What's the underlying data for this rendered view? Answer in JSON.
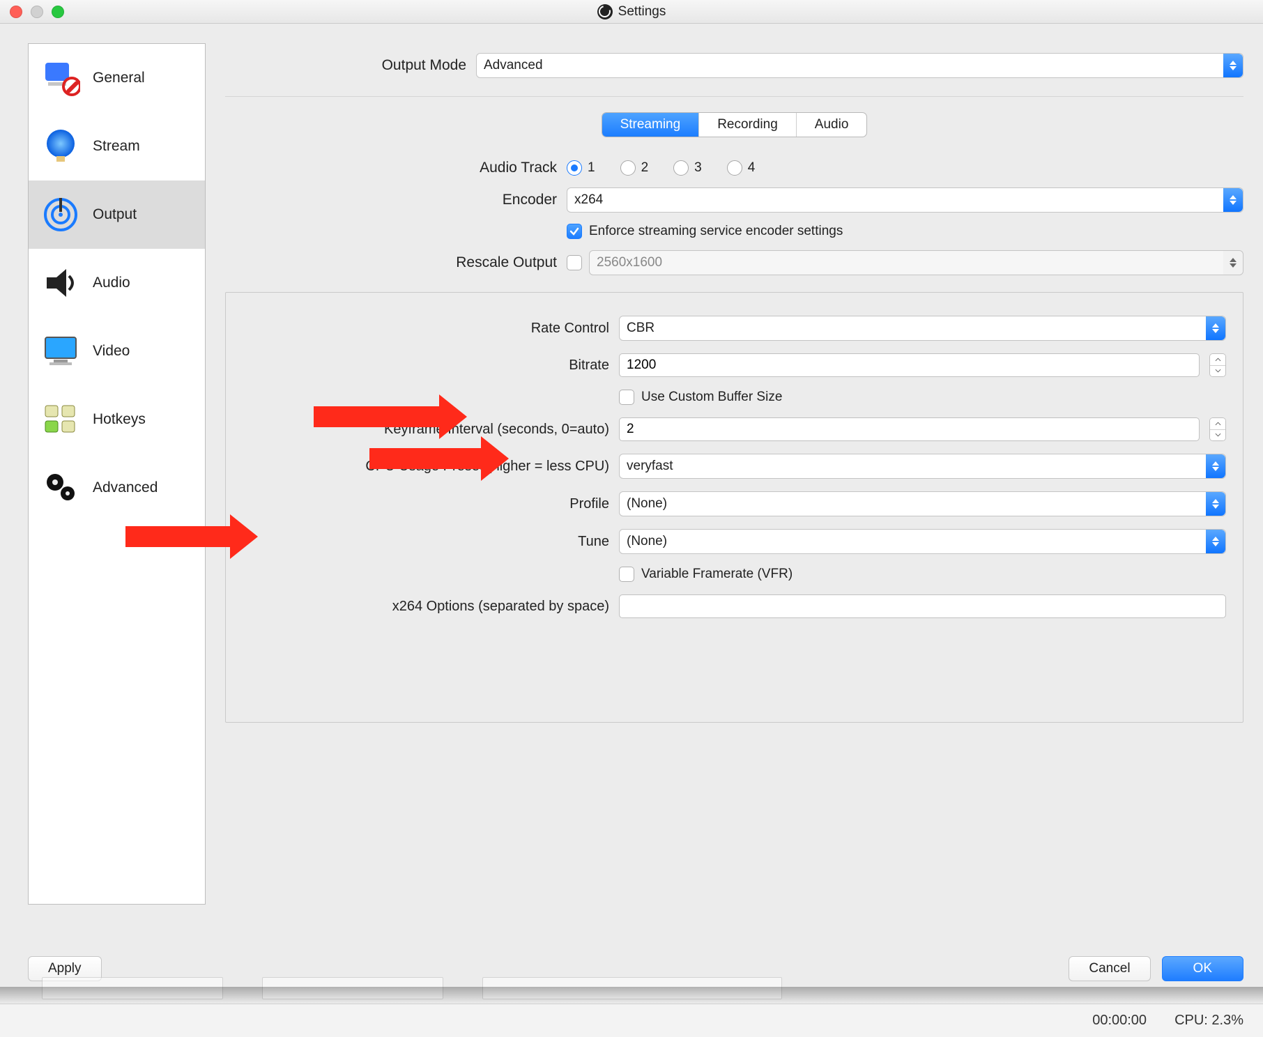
{
  "title": "Settings",
  "sidebar": {
    "items": [
      {
        "label": "General"
      },
      {
        "label": "Stream"
      },
      {
        "label": "Output"
      },
      {
        "label": "Audio"
      },
      {
        "label": "Video"
      },
      {
        "label": "Hotkeys"
      },
      {
        "label": "Advanced"
      }
    ],
    "selected_index": 2
  },
  "top": {
    "output_mode_label": "Output Mode",
    "output_mode_value": "Advanced"
  },
  "tabs": {
    "streaming": "Streaming",
    "recording": "Recording",
    "audio": "Audio",
    "active": "streaming"
  },
  "streaming": {
    "audio_track_label": "Audio Track",
    "tracks": [
      "1",
      "2",
      "3",
      "4"
    ],
    "track_selected": 0,
    "encoder_label": "Encoder",
    "encoder_value": "x264",
    "enforce_label": "Enforce streaming service encoder settings",
    "enforce_checked": true,
    "rescale_label": "Rescale Output",
    "rescale_checked": false,
    "rescale_value": "2560x1600"
  },
  "panel": {
    "rate_control_label": "Rate Control",
    "rate_control_value": "CBR",
    "bitrate_label": "Bitrate",
    "bitrate_value": "1200",
    "custom_buffer_label": "Use Custom Buffer Size",
    "custom_buffer_checked": false,
    "keyframe_label": "Keyframe Interval (seconds, 0=auto)",
    "keyframe_value": "2",
    "cpu_preset_label": "CPU Usage Preset (higher = less CPU)",
    "cpu_preset_value": "veryfast",
    "profile_label": "Profile",
    "profile_value": "(None)",
    "tune_label": "Tune",
    "tune_value": "(None)",
    "vfr_label": "Variable Framerate (VFR)",
    "vfr_checked": false,
    "x264opts_label": "x264 Options (separated by space)",
    "x264opts_value": ""
  },
  "footer": {
    "apply": "Apply",
    "cancel": "Cancel",
    "ok": "OK"
  },
  "status": {
    "time": "00:00:00",
    "cpu": "CPU: 2.3%"
  }
}
